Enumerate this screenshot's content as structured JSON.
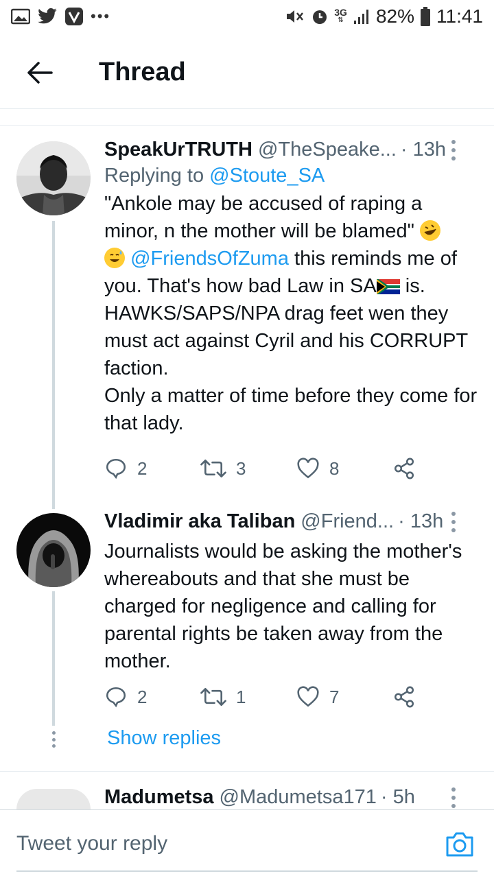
{
  "status_bar": {
    "battery": "82%",
    "time": "11:41",
    "network": "3G"
  },
  "header": {
    "title": "Thread"
  },
  "tweets": [
    {
      "name": "SpeakUrTRUTH",
      "handle": "@TheSpeake...",
      "time": "· 13h",
      "replying_prefix": "Replying to ",
      "replying_to": "@Stoute_SA",
      "text_1": "\"Ankole may be accused of raping a minor, n the mother will be blamed\"",
      "mention": "@FriendsOfZuma",
      "text_2": " this reminds me of you. That's how bad Law in SA",
      "text_3": " is. HAWKS/SAPS/NPA drag feet wen they must act against Cyril and his CORRUPT faction.",
      "text_4": "Only a matter of time before they come for that lady.",
      "replies": "2",
      "retweets": "3",
      "likes": "8"
    },
    {
      "name": "Vladimir aka Taliban",
      "handle": "@Friend...",
      "time": "· 13h",
      "text": "Journalists would be asking the mother's whereabouts and that she must be charged for negligence and calling for parental rights be taken away from the mother.",
      "replies": "2",
      "retweets": "1",
      "likes": "7"
    },
    {
      "name": "Madumetsa",
      "handle": "@Madumetsa171",
      "time": "· 5h"
    }
  ],
  "show_replies": "Show replies",
  "reply_bar": {
    "placeholder": "Tweet your reply"
  },
  "colors": {
    "accent": "#1d9bf0",
    "secondary_text": "#536471"
  }
}
